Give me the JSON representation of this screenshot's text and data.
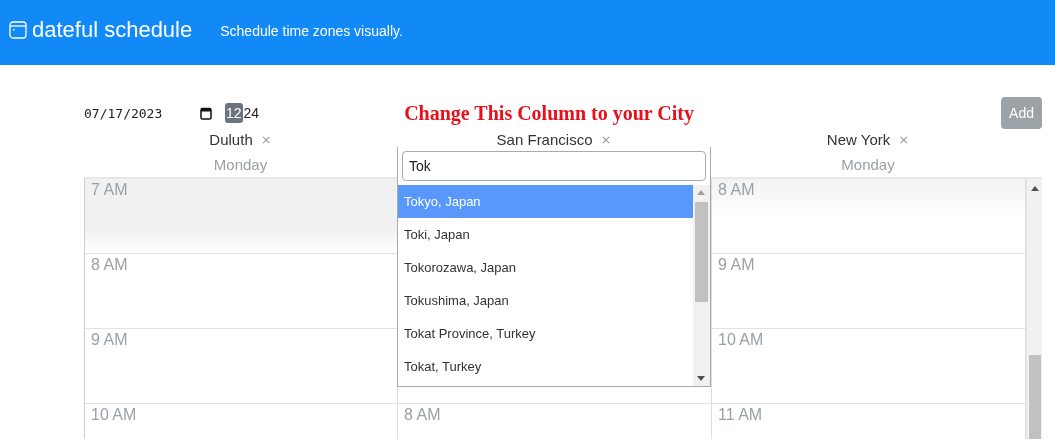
{
  "header": {
    "title": "dateful schedule",
    "tagline": "Schedule time zones visually."
  },
  "toolbar": {
    "date": "07/17/2023",
    "formats": [
      {
        "label": "12",
        "selected": true
      },
      {
        "label": "24",
        "selected": false
      }
    ],
    "notice": "Change This Column to your City",
    "add_button": "Add"
  },
  "columns": [
    {
      "city": "Duluth",
      "remove": "×",
      "day": "Monday",
      "hours": [
        "7 AM",
        "8 AM",
        "9 AM",
        "10 AM"
      ]
    },
    {
      "city": "San Francisco",
      "remove": "×",
      "hours": [
        "8 AM"
      ]
    },
    {
      "city": "New York",
      "remove": "×",
      "day": "Monday",
      "hours": [
        "8 AM",
        "9 AM",
        "10 AM",
        "11 AM"
      ]
    }
  ],
  "city_search": {
    "value": "Tok",
    "options": [
      {
        "label": "Tokyo, Japan",
        "selected": true
      },
      {
        "label": "Toki, Japan",
        "selected": false
      },
      {
        "label": "Tokorozawa, Japan",
        "selected": false
      },
      {
        "label": "Tokushima, Japan",
        "selected": false
      },
      {
        "label": "Tokat Province, Turkey",
        "selected": false
      },
      {
        "label": "Tokat, Turkey",
        "selected": false
      }
    ]
  }
}
